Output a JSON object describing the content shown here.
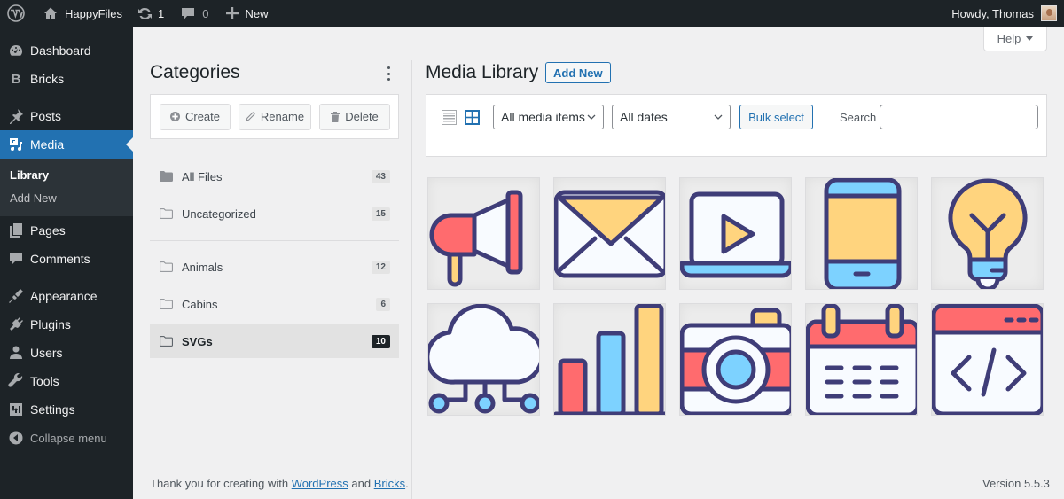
{
  "adminbar": {
    "site_name": "HappyFiles",
    "updates_count": "1",
    "comments_count": "0",
    "new_label": "New",
    "greeting": "Howdy, Thomas",
    "icons": {
      "logo": "wordpress-logo-icon",
      "home": "home-icon",
      "updates": "updates-icon",
      "comments": "comment-icon",
      "new": "plus-icon"
    }
  },
  "sidebar": {
    "items": [
      {
        "label": "Dashboard",
        "icon": "dashboard-icon"
      },
      {
        "label": "Bricks",
        "icon": "bricks-icon"
      },
      {
        "label": "Posts",
        "icon": "pin-icon"
      },
      {
        "label": "Media",
        "icon": "media-icon",
        "current": true
      },
      {
        "label": "Pages",
        "icon": "pages-icon"
      },
      {
        "label": "Comments",
        "icon": "comments-icon"
      },
      {
        "label": "Appearance",
        "icon": "brush-icon"
      },
      {
        "label": "Plugins",
        "icon": "plug-icon"
      },
      {
        "label": "Users",
        "icon": "user-icon"
      },
      {
        "label": "Tools",
        "icon": "wrench-icon"
      },
      {
        "label": "Settings",
        "icon": "settings-icon"
      }
    ],
    "submenu": [
      {
        "label": "Library",
        "current": true
      },
      {
        "label": "Add New"
      }
    ],
    "collapse_label": "Collapse menu"
  },
  "categories": {
    "title": "Categories",
    "actions": {
      "create": "Create",
      "rename": "Rename",
      "delete": "Delete"
    },
    "system": [
      {
        "name": "All Files",
        "count": "43"
      },
      {
        "name": "Uncategorized",
        "count": "15"
      }
    ],
    "folders": [
      {
        "name": "Animals",
        "count": "12"
      },
      {
        "name": "Cabins",
        "count": "6"
      },
      {
        "name": "SVGs",
        "count": "10",
        "active": true
      }
    ]
  },
  "media": {
    "title": "Media Library",
    "add_new": "Add New",
    "help_label": "Help",
    "filter_type": "All media items",
    "filter_date": "All dates",
    "bulk_select": "Bulk select",
    "search_label": "Search",
    "search_value": "",
    "items": [
      {
        "name": "megaphone"
      },
      {
        "name": "envelope"
      },
      {
        "name": "laptop-video"
      },
      {
        "name": "smartphone"
      },
      {
        "name": "lightbulb"
      },
      {
        "name": "cloud-network"
      },
      {
        "name": "bar-chart"
      },
      {
        "name": "camera"
      },
      {
        "name": "calendar"
      },
      {
        "name": "code-window"
      }
    ]
  },
  "footer": {
    "text_before": "Thank you for creating with ",
    "link1": "WordPress",
    "text_middle": " and ",
    "link2": "Bricks",
    "text_after": ".",
    "version": "Version 5.5.3"
  },
  "colors": {
    "accent": "#2271b1",
    "adminbar": "#1d2327",
    "icon_stroke": "#3f3d78",
    "red": "#ff6b6e",
    "yellow": "#ffd47e",
    "blue": "#7dd2ff"
  }
}
